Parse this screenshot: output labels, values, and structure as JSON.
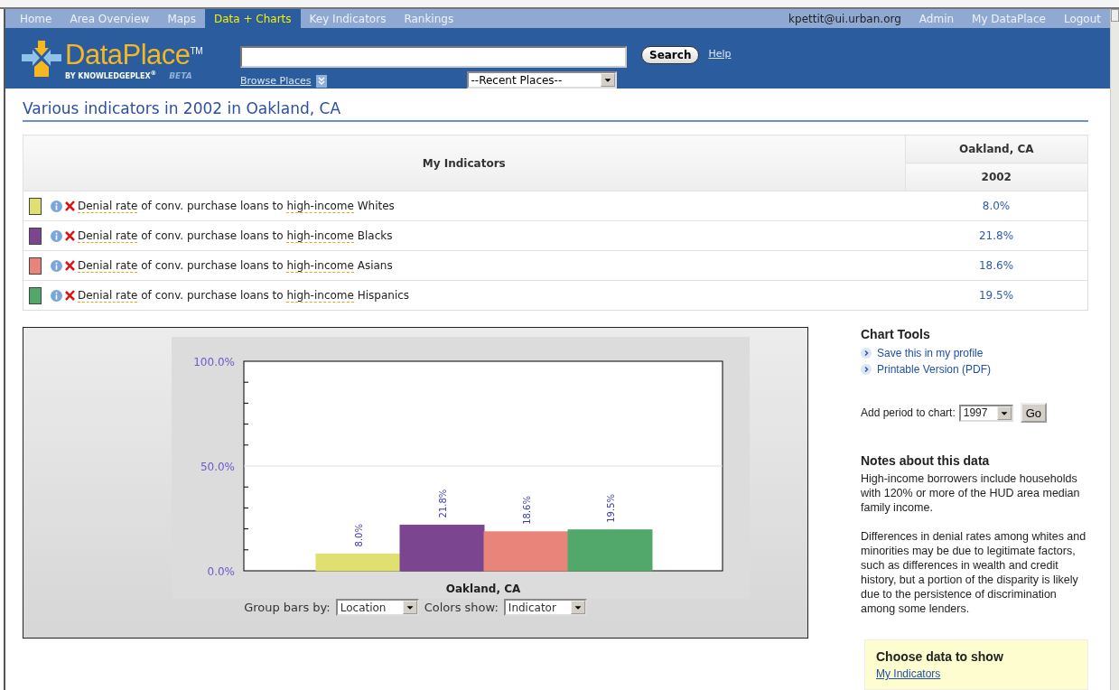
{
  "nav": {
    "tabs": [
      {
        "label": "Home",
        "selected": false
      },
      {
        "label": "Area Overview",
        "selected": false
      },
      {
        "label": "Maps",
        "selected": false
      },
      {
        "label": "Data + Charts",
        "selected": true
      },
      {
        "label": "Key Indicators",
        "selected": false
      },
      {
        "label": "Rankings",
        "selected": false
      }
    ],
    "user": "kpettit@ui.urban.org",
    "links": [
      "Admin",
      "My DataPlace",
      "Logout"
    ]
  },
  "header": {
    "logo": {
      "name": "DataPlace",
      "tm": "TM",
      "byline": "BY KNOWLEDGEPLEX",
      "mark": "®",
      "beta": "BETA"
    },
    "search_button": "Search",
    "help": "Help",
    "browse": "Browse Places",
    "recent": "--Recent Places--"
  },
  "title": "Various indicators in 2002 in Oakland, CA",
  "table": {
    "indicator_heading": "My Indicators",
    "place": "Oakland, CA",
    "year": "2002",
    "rows": [
      {
        "color": "#e0e070",
        "parts": [
          {
            "text": "Denial rate",
            "term": true
          },
          {
            "text": " of conv. purchase loans to ",
            "term": false
          },
          {
            "text": "high-income",
            "term": true
          },
          {
            "text": " Whites",
            "term": false
          }
        ],
        "value": "8.0%"
      },
      {
        "color": "#7b4590",
        "parts": [
          {
            "text": "Denial rate",
            "term": true
          },
          {
            "text": " of conv. purchase loans to ",
            "term": false
          },
          {
            "text": "high-income",
            "term": true
          },
          {
            "text": " Blacks",
            "term": false
          }
        ],
        "value": "21.8%"
      },
      {
        "color": "#e8847a",
        "parts": [
          {
            "text": "Denial rate",
            "term": true
          },
          {
            "text": " of conv. purchase loans to ",
            "term": false
          },
          {
            "text": "high-income",
            "term": true
          },
          {
            "text": " Asians",
            "term": false
          }
        ],
        "value": "18.6%"
      },
      {
        "color": "#52a86a",
        "parts": [
          {
            "text": "Denial rate",
            "term": true
          },
          {
            "text": " of conv. purchase loans to ",
            "term": false
          },
          {
            "text": "high-income",
            "term": true
          },
          {
            "text": " Hispanics",
            "term": false
          }
        ],
        "value": "19.5%"
      }
    ]
  },
  "chart": {
    "chart_data": {
      "type": "bar",
      "categories": [
        "Oakland, CA"
      ],
      "ylim": [
        0,
        100
      ],
      "yticks": [
        {
          "value": 0,
          "label": "0.0%"
        },
        {
          "value": 50,
          "label": "50.0%"
        },
        {
          "value": 100,
          "label": "100.0%"
        }
      ],
      "value_labels": [
        [
          "8.0%"
        ],
        [
          "21.8%"
        ],
        [
          "18.6%"
        ],
        [
          "19.5%"
        ]
      ],
      "series": [
        {
          "color": "#e0e070",
          "values": [
            8.0
          ]
        },
        {
          "color": "#7b4590",
          "values": [
            21.8
          ]
        },
        {
          "color": "#e8847a",
          "values": [
            18.6
          ]
        },
        {
          "color": "#52a86a",
          "values": [
            19.5
          ]
        }
      ]
    },
    "group_label": "Group bars by:",
    "group_value": "Location",
    "colors_label": "Colors show:",
    "colors_value": "Indicator"
  },
  "tools": {
    "heading": "Chart Tools",
    "links": [
      "Save this in my profile",
      "Printable Version (PDF)"
    ],
    "period_label": "Add period to chart:",
    "period_value": "1997",
    "go": "Go"
  },
  "notes": {
    "heading": "Notes about this data",
    "paragraphs": [
      "High-income borrowers include households with 120% or more of the HUD area median family income.",
      "Differences in denial rates among whites and minorities may be due to legitimate factors, such as differences in wealth and credit history, but a portion of the disparity is likely due to the persistence of discrimination among some lenders."
    ]
  },
  "choose": {
    "heading": "Choose data to show",
    "link": "My Indicators"
  }
}
